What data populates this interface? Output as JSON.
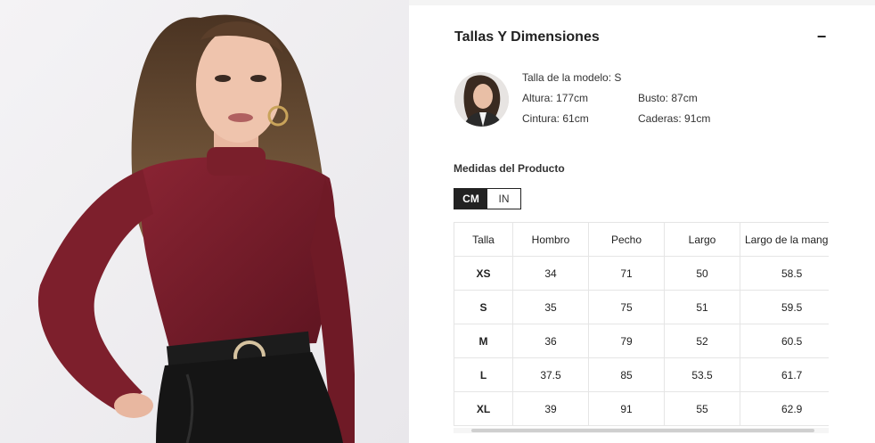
{
  "section": {
    "title": "Tallas Y Dimensiones",
    "collapse_icon": "−"
  },
  "model": {
    "size_label": "Talla de la modelo: S",
    "height": "Altura: 177cm",
    "bust": "Busto: 87cm",
    "waist": "Cintura: 61cm",
    "hips": "Caderas: 91cm"
  },
  "measurements": {
    "title": "Medidas del Producto",
    "units": [
      "CM",
      "IN"
    ],
    "selected_unit": "CM"
  },
  "size_table": {
    "headers": [
      "Talla",
      "Hombro",
      "Pecho",
      "Largo",
      "Largo de la manga"
    ],
    "rows": [
      [
        "XS",
        "34",
        "71",
        "50",
        "58.5"
      ],
      [
        "S",
        "35",
        "75",
        "51",
        "59.5"
      ],
      [
        "M",
        "36",
        "79",
        "52",
        "60.5"
      ],
      [
        "L",
        "37.5",
        "85",
        "53.5",
        "61.7"
      ],
      [
        "XL",
        "39",
        "91",
        "55",
        "62.9"
      ]
    ]
  },
  "colors": {
    "garment": "#7a1f2b",
    "accent": "#222222",
    "border": "#e5e5e5"
  },
  "icons": {
    "collapse": "minus-icon"
  }
}
